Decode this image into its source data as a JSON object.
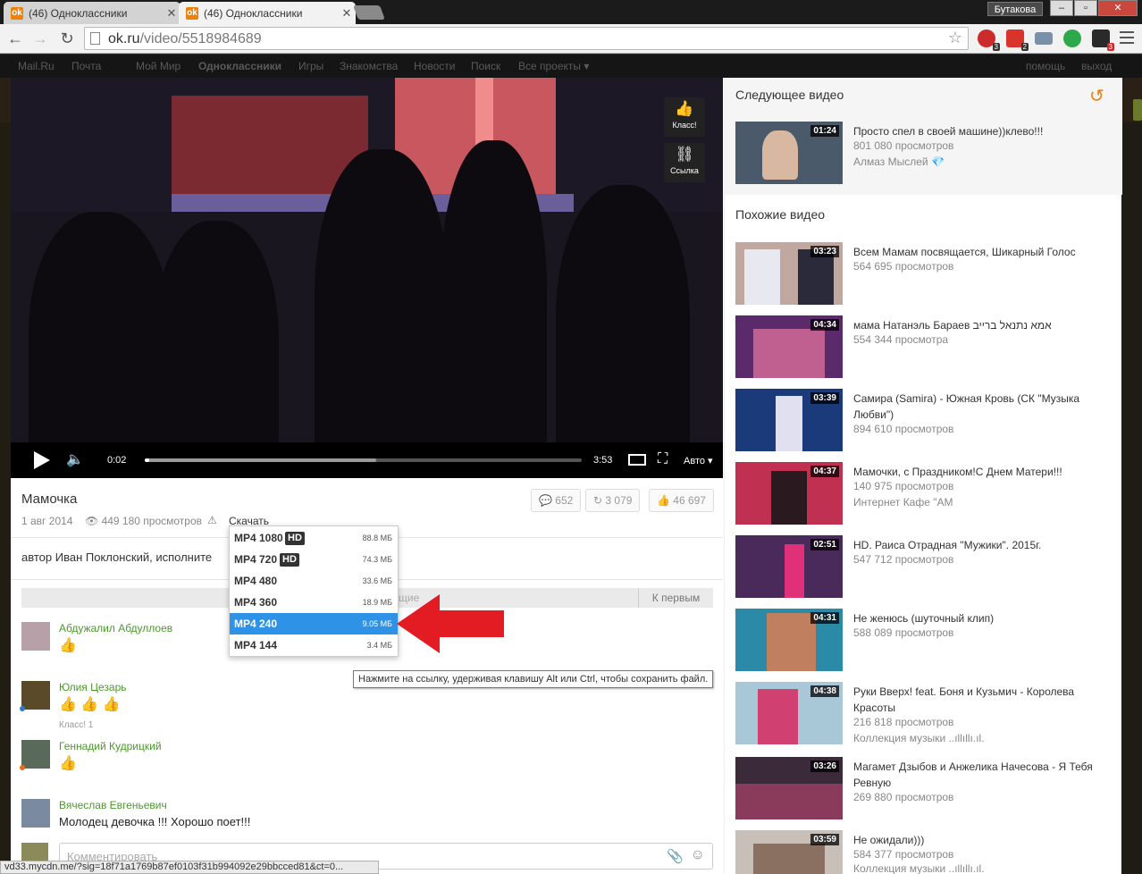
{
  "browser": {
    "tabs": [
      {
        "title": "(46) Одноклассники",
        "active": false
      },
      {
        "title": "(46) Одноклассники",
        "active": true
      }
    ],
    "profile": "Бутакова",
    "url_host": "ok.ru",
    "url_path": "/video/5518984689",
    "extensions": [
      {
        "name": "shield-ext",
        "badge": "3",
        "color": "#cc2b2b"
      },
      {
        "name": "gift-ext",
        "badge": "2",
        "color": "#d9342b"
      },
      {
        "name": "mail-ext",
        "badge": "",
        "color": "#7a8fa8"
      },
      {
        "name": "green-ext",
        "badge": "",
        "color": "#2da84a"
      },
      {
        "name": "cast-ext",
        "badge": "3",
        "color": "#2a2a2a"
      }
    ]
  },
  "topnav": {
    "items": [
      "Mail.Ru",
      "Почта",
      "Мой Мир",
      "Одноклассники",
      "Игры",
      "Знакомства",
      "Новости",
      "Поиск",
      "Все проекты ▾"
    ],
    "right": [
      "помощь",
      "выход"
    ]
  },
  "player": {
    "class_label": "Класс!",
    "link_label": "Ссылка",
    "time_current": "0:02",
    "time_total": "3:53",
    "quality": "Авто ▾",
    "played_fraction": 0.01,
    "buffered_fraction": 0.53
  },
  "video": {
    "title": "Мамочка",
    "date": "1 авг 2014",
    "views": "449 180 просмотров",
    "download_label": "Скачать",
    "description": "автор Иван Поклонский, исполните",
    "comments_count": "652",
    "shares_count": "3 079",
    "likes_count": "46 697"
  },
  "download_menu": {
    "items": [
      {
        "label": "MP4 1080",
        "hd": "HD",
        "size": "88.8 МБ",
        "selected": false
      },
      {
        "label": "MP4 720",
        "hd": "HD",
        "size": "74.3 МБ",
        "selected": false
      },
      {
        "label": "MP4 480",
        "hd": "",
        "size": "33.6 МБ",
        "selected": false
      },
      {
        "label": "MP4 360",
        "hd": "",
        "size": "18.9 МБ",
        "selected": false
      },
      {
        "label": "MP4 240",
        "hd": "",
        "size": "9.05 МБ",
        "selected": true
      },
      {
        "label": "MP4 144",
        "hd": "",
        "size": "3.4 МБ",
        "selected": false
      }
    ],
    "tooltip": "Нажмите на ссылку, удерживая клавишу Alt или Ctrl, чтобы сохранить файл."
  },
  "comments": {
    "sort_partial": "ущие",
    "first_label": "К первым",
    "items": [
      {
        "author": "Абдужалил Абдуллоев",
        "thumbs": "👍",
        "text": "",
        "klass": ""
      },
      {
        "author": "Юлия Цезарь",
        "thumbs": "👍 👍 👍",
        "text": "",
        "klass": "Класс! 1"
      },
      {
        "author": "Геннадий Кудрицкий",
        "thumbs": "👍",
        "text": "",
        "klass": ""
      },
      {
        "author": "Вячеслав Евгеньевич",
        "thumbs": "",
        "text": "Молодец девочка !!!    Хорошо поет!!!",
        "klass": ""
      }
    ],
    "input_placeholder": "Комментировать"
  },
  "sidebar": {
    "next_heading": "Следующее видео",
    "next": {
      "duration": "01:24",
      "title": "Просто спел в своей машине))клево!!!",
      "views": "801 080 просмотров",
      "channel": "Алмаз Мыслей 💎"
    },
    "similar_heading": "Похожие видео",
    "similar": [
      {
        "duration": "03:23",
        "title": "Всем Мамам посвящается, Шикарный Голос",
        "views": "564 695 просмотров",
        "channel": ""
      },
      {
        "duration": "04:34",
        "title": "мама Натанэль Бараев אמא נתנאל ברייב",
        "views": "554 344 просмотра",
        "channel": ""
      },
      {
        "duration": "03:39",
        "title": "Самира (Samira) - Южная Кровь (СК \"Музыка Любви\")",
        "views": "894 610 просмотров",
        "channel": ""
      },
      {
        "duration": "04:37",
        "title": "Мамочки, с Праздником!С Днем Матери!!!",
        "views": "140 975 просмотров",
        "channel": "Интернет Кафе \"АМ"
      },
      {
        "duration": "02:51",
        "title": "HD. Раиса Отрадная \"Мужики\". 2015г.",
        "views": "547 712 просмотров",
        "channel": ""
      },
      {
        "duration": "04:31",
        "title": "Не женюсь (шуточный клип)",
        "views": "588 089 просмотров",
        "channel": ""
      },
      {
        "duration": "04:38",
        "title": "Руки Вверх! feat. Боня и Кузьмич - Королева Красоты",
        "views": "216 818 просмотров",
        "channel": "Коллекция музыки ..ıllıllı.ıl."
      },
      {
        "duration": "03:26",
        "title": "Магамет Дзыбов и Анжелика Начесова - Я Тебя Ревную",
        "views": "269 880 просмотров",
        "channel": ""
      },
      {
        "duration": "03:59",
        "title": "Не ожидали)))",
        "views": "584 377 просмотров",
        "channel": "Коллекция музыки ..ıllıllı.ıl."
      }
    ]
  },
  "status_bar": "vd33.mycdn.me/?sig=18f71a1769b87ef0103f31b994092e29bbcced81&ct=0..."
}
